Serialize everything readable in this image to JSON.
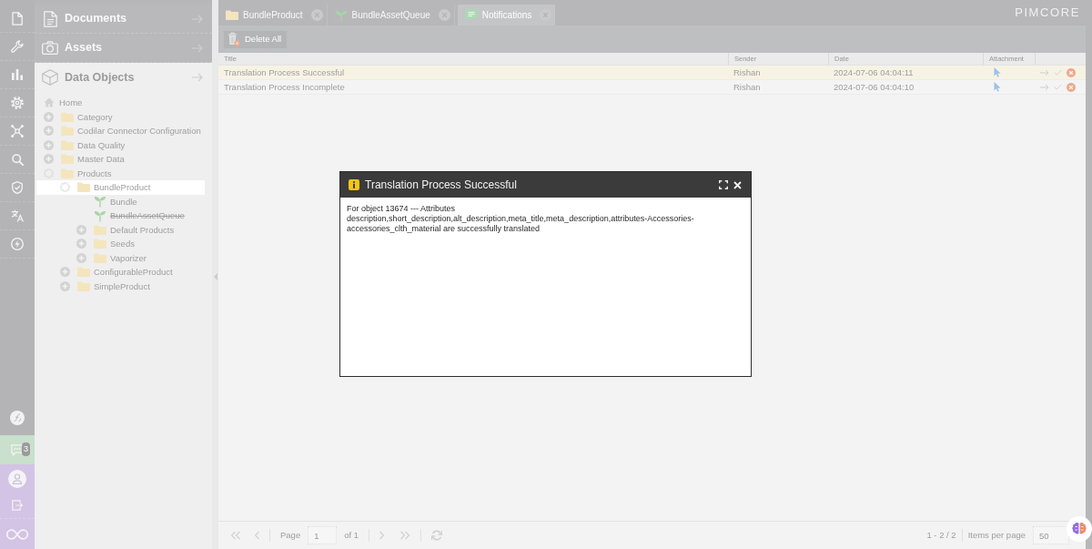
{
  "left_toolbar": {
    "notification_badge": "3"
  },
  "tree_panel": {
    "sections": [
      {
        "label": "Documents",
        "expanded": false
      },
      {
        "label": "Assets",
        "expanded": false
      },
      {
        "label": "Data Objects",
        "expanded": true
      }
    ],
    "tree": {
      "label": "Home",
      "kind": "home",
      "selected": false,
      "children": [
        {
          "label": "Category",
          "kind": "folder",
          "expanded": false,
          "selected": false
        },
        {
          "label": "Codilar Connector Configuration",
          "kind": "folder",
          "expanded": false,
          "selected": false
        },
        {
          "label": "Data Quality",
          "kind": "folder",
          "expanded": false,
          "selected": false
        },
        {
          "label": "Master Data",
          "kind": "folder",
          "expanded": false,
          "selected": false
        },
        {
          "label": "Products",
          "kind": "folder",
          "expanded": true,
          "selected": false,
          "children": [
            {
              "label": "BundleProduct",
              "kind": "folder",
              "expanded": true,
              "selected": true,
              "children": [
                {
                  "label": "Bundle",
                  "kind": "object",
                  "published": true,
                  "selected": false
                },
                {
                  "label": "BundleAssetQueue",
                  "kind": "object",
                  "published": false,
                  "selected": false
                },
                {
                  "label": "Default Products",
                  "kind": "folder",
                  "expanded": false,
                  "selected": false
                },
                {
                  "label": "Seeds",
                  "kind": "folder",
                  "expanded": false,
                  "selected": false
                },
                {
                  "label": "Vaporizer",
                  "kind": "folder",
                  "expanded": false,
                  "selected": false
                }
              ]
            },
            {
              "label": "ConfigurableProduct",
              "kind": "folder",
              "expanded": false,
              "selected": false
            },
            {
              "label": "SimpleProduct",
              "kind": "folder",
              "expanded": false,
              "selected": false
            }
          ]
        }
      ]
    }
  },
  "tabs": [
    {
      "label": "BundleProduct",
      "kind": "folder",
      "selected": false
    },
    {
      "label": "BundleAssetQueue",
      "kind": "object",
      "selected": false
    },
    {
      "label": "Notifications",
      "kind": "notifications",
      "selected": true
    }
  ],
  "logo": "PIMCORE",
  "toolbar": {
    "buttons": [
      "Delete All"
    ]
  },
  "table": {
    "columns": [
      "Title",
      "Sender",
      "Date",
      "Attachment"
    ],
    "rows": [
      {
        "title": "Translation Process Successful",
        "sender": "Rishan",
        "date": "2024-07-06 04:04:11",
        "selected": true
      },
      {
        "title": "Translation Process Incomplete",
        "sender": "Rishan",
        "date": "2024-07-06 04:04:10",
        "selected": false
      }
    ]
  },
  "pagination": {
    "page_label": "Page",
    "page": "1",
    "page_count": "of 1",
    "summary": "1 - 2 / 2",
    "page_size_label": "Items per page",
    "page_size": "50"
  },
  "dialog": {
    "title": "Translation Process Successful",
    "body": "For object 13674 --- Attributes description,short_description,alt_description,meta_title,meta_description,attributes-Accessories-accessories_clth_material are successfully translated"
  }
}
